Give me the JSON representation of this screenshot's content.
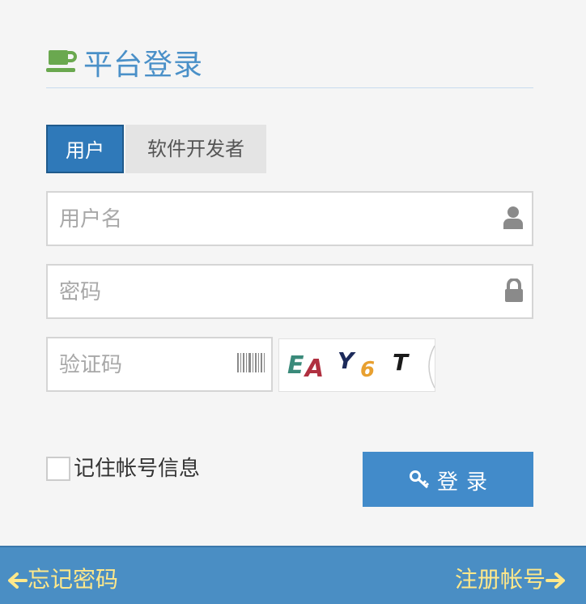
{
  "header": {
    "title": "平台登录",
    "icon": "coffee-cup-icon",
    "icon_color": "#6aa84f",
    "title_color": "#4a90c8"
  },
  "tabs": [
    {
      "label": "用户",
      "active": true
    },
    {
      "label": "软件开发者",
      "active": false
    }
  ],
  "form": {
    "username": {
      "placeholder": "用户名",
      "value": "",
      "icon": "user-icon"
    },
    "password": {
      "placeholder": "密码",
      "value": "",
      "icon": "lock-icon"
    },
    "captcha": {
      "placeholder": "验证码",
      "value": "",
      "icon": "barcode-icon",
      "image_text": "EAY6T"
    },
    "remember": {
      "label": "记住帐号信息",
      "checked": false
    },
    "login_button": {
      "label": "登录",
      "icon": "key-icon",
      "color": "#428bca"
    }
  },
  "footer": {
    "forgot_label": "忘记密码",
    "register_label": "注册帐号",
    "background": "#4a8ec4",
    "link_color": "#ffe88a"
  }
}
